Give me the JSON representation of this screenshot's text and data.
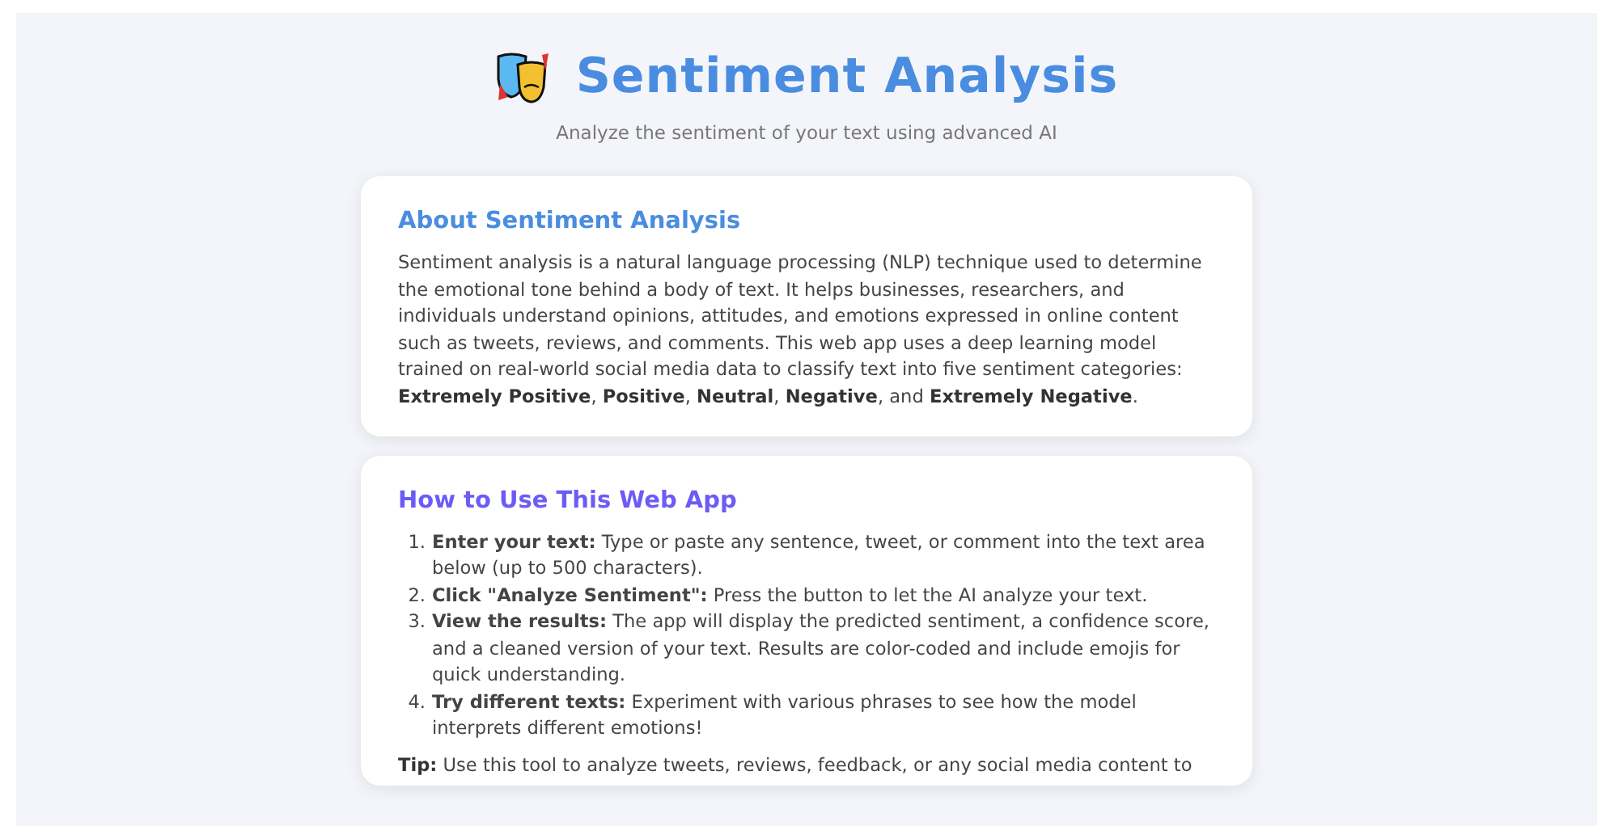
{
  "header": {
    "title": "Sentiment Analysis",
    "subtitle": "Analyze the sentiment of your text using advanced AI"
  },
  "about": {
    "title": "About Sentiment Analysis",
    "text": "Sentiment analysis is a natural language processing (NLP) technique used to determine the emotional tone behind a body of text. It helps businesses, researchers, and individuals understand opinions, attitudes, and emotions expressed in online content such as tweets, reviews, and comments. This web app uses a deep learning model trained on real-world social media data to classify text into five sentiment categories: **Extremely Positive**, **Positive**, **Neutral**, **Negative**, and **Extremely Negative**."
  },
  "how_to": {
    "title": "How to Use This Web App",
    "steps": [
      {
        "number": "1.",
        "text": "**Enter your text:** Type or paste any sentence, tweet, or comment into the text area below (up to 500 characters)."
      },
      {
        "number": "2.",
        "text": "**Click \"Analyze Sentiment\":** Press the button to let the AI analyze your text."
      },
      {
        "number": "3.",
        "text": "**View the results:** The app will display the predicted sentiment, a confidence score, and a cleaned version of your text. Results are color-coded and include emojis for quick understanding."
      },
      {
        "number": "4.",
        "text": "**Try different texts:** Experiment with various phrases to see how the model interprets different emotions!"
      }
    ],
    "tip": "**Tip:** Use this tool to analyze tweets, reviews, feedback, or any social media content to"
  }
}
